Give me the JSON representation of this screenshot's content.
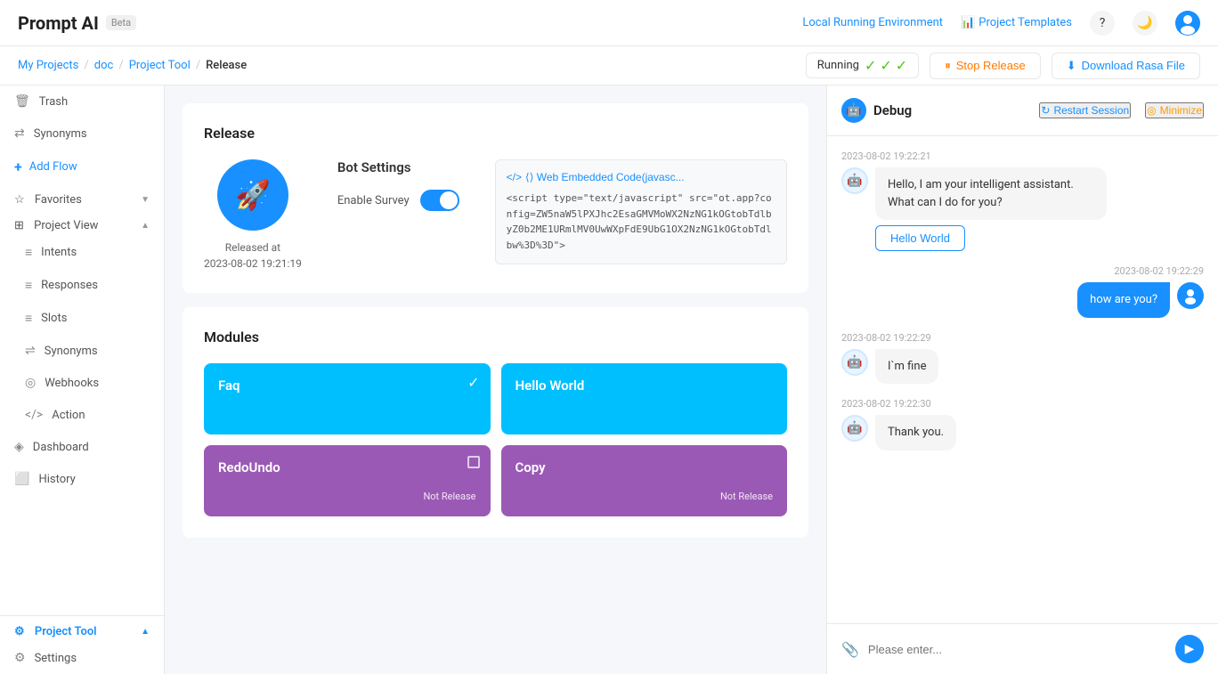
{
  "app": {
    "title": "Prompt AI",
    "beta_label": "Beta"
  },
  "topnav": {
    "env_link": "Local Running Environment",
    "templates_link": "Project Templates",
    "help_icon": "?",
    "theme_icon": "🌙",
    "avatar_icon": "👤"
  },
  "breadcrumb": {
    "my_projects": "My Projects",
    "doc": "doc",
    "project_tool": "Project Tool",
    "release": "Release",
    "status": "Running"
  },
  "breadcrumb_actions": {
    "stop_label": "Stop Release",
    "download_label": "Download Rasa File"
  },
  "sidebar": {
    "trash_label": "Trash",
    "synonyms_top_label": "Synonyms",
    "add_flow_label": "Add Flow",
    "favorites_label": "Favorites",
    "project_view_label": "Project View",
    "intents_label": "Intents",
    "responses_label": "Responses",
    "slots_label": "Slots",
    "synonyms_label": "Synonyms",
    "webhooks_label": "Webhooks",
    "action_label": "Action",
    "dashboard_label": "Dashboard",
    "history_label": "History",
    "project_tool_label": "Project Tool",
    "settings_label": "Settings"
  },
  "release": {
    "section_title": "Release",
    "released_at_label": "Released at",
    "released_date": "2023-08-02 19:21:19",
    "bot_settings_title": "Bot Settings",
    "enable_survey_label": "Enable Survey",
    "embed_code_header": "⟨⟩ Web Embedded Code(javasc...",
    "embed_code": "<script type=\"text/javascript\" src=\"ot.app?config=ZW5naW5lPXJhc2EsaGMVMoWX2NzNG1kOGtobTdlbyZ0b2ME1URmlMV0UwWXpFdE9UbG1OX2NzNG1kOGtobTdlbw%3D%3D\">"
  },
  "modules": {
    "section_title": "Modules",
    "cards": [
      {
        "name": "Faq",
        "color": "blue",
        "status": "",
        "checked": true
      },
      {
        "name": "Hello World",
        "color": "blue",
        "status": "",
        "checked": false
      },
      {
        "name": "RedoUndo",
        "color": "purple",
        "status": "Not Release",
        "checked": false
      },
      {
        "name": "Copy",
        "color": "purple",
        "status": "Not Release",
        "checked": false
      }
    ]
  },
  "debug": {
    "title": "Debug",
    "restart_label": "Restart Session",
    "minimize_label": "Minimize",
    "messages": [
      {
        "id": 1,
        "timestamp": "2023-08-02 19:22:21",
        "sender": "bot",
        "text": "Hello, I am your intelligent assistant. What can I do for you?",
        "button": "Hello World"
      },
      {
        "id": 2,
        "timestamp": "2023-08-02 19:22:29",
        "sender": "user",
        "text": "how are you?"
      },
      {
        "id": 3,
        "timestamp": "2023-08-02 19:22:29",
        "sender": "bot",
        "text": "I`m fine"
      },
      {
        "id": 4,
        "timestamp": "2023-08-02 19:22:30",
        "sender": "bot",
        "text": "Thank you."
      }
    ],
    "input_placeholder": "Please enter..."
  }
}
